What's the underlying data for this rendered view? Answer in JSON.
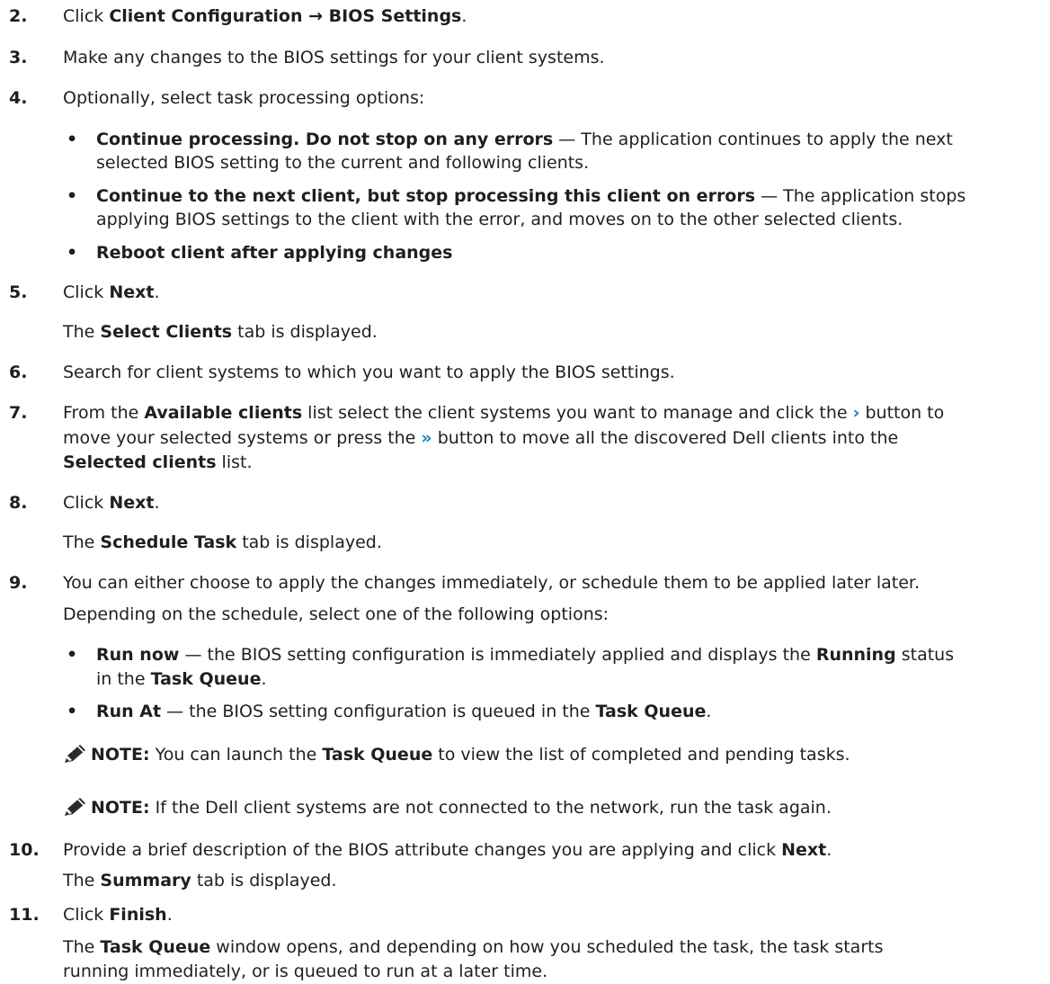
{
  "steps": {
    "s2": {
      "num": "2.",
      "pre": "Click ",
      "b1": "Client Configuration",
      "arrow": " → ",
      "b2": "BIOS Settings",
      "post": "."
    },
    "s3": {
      "num": "3.",
      "text": "Make any changes to the BIOS settings for your client systems."
    },
    "s4": {
      "num": "4.",
      "text": "Optionally, select task processing options:",
      "bullets": [
        {
          "bold": "Continue processing. Do not stop on any errors",
          "line1": " — The application continues to apply the next",
          "line2": "selected BIOS setting to the current and following clients."
        },
        {
          "bold": "Continue to the next client, but stop processing this client on errors",
          "line1": " — The application stops",
          "line2": "applying BIOS settings to the client with the error, and moves on to the other selected clients."
        },
        {
          "bold": "Reboot client after applying changes"
        }
      ]
    },
    "s5": {
      "num": "5.",
      "pre": "Click ",
      "bold": "Next",
      "post": ".",
      "r_pre": "The ",
      "r_bold": "Select Clients",
      "r_post": " tab is displayed."
    },
    "s6": {
      "num": "6.",
      "text": "Search for client systems to which you want to apply the BIOS settings."
    },
    "s7": {
      "num": "7.",
      "l1_pre": "From the ",
      "l1_bold": "Available clients",
      "l1_mid": " list select the client systems you want to manage and click the ",
      "l1_icon": "›",
      "l1_post": " button to",
      "l2_pre": "move your selected systems or press the ",
      "l2_icon": "»",
      "l2_post": " button to move all the discovered Dell clients into the",
      "l3_bold": "Selected clients",
      "l3_post": " list."
    },
    "s8": {
      "num": "8.",
      "pre": "Click ",
      "bold": "Next",
      "post": ".",
      "r_pre": "The ",
      "r_bold": "Schedule Task",
      "r_post": " tab is displayed."
    },
    "s9": {
      "num": "9.",
      "text": "You can either choose to apply the changes immediately, or schedule them to be applied later later.",
      "text2": "Depending on the schedule, select one of the following options:",
      "bullets": [
        {
          "bold": "Run now",
          "l1a": " — the BIOS setting configuration is immediately applied and displays the ",
          "l1b": "Running",
          "l1c": " status",
          "l2a": "in the ",
          "l2b": "Task Queue",
          "l2c": "."
        },
        {
          "bold": "Run At",
          "l1a": " — the BIOS setting configuration is queued in the ",
          "l1b": "Task Queue",
          "l1c": "."
        }
      ],
      "notes": [
        {
          "label": "NOTE:",
          "a": " You can launch the ",
          "b": "Task Queue",
          "c": " to view the list of completed and pending tasks."
        },
        {
          "label": "NOTE:",
          "a": " If the Dell client systems are not connected to the network, run the task again.",
          "b": "",
          "c": ""
        }
      ]
    },
    "s10": {
      "num": "10.",
      "pre": "Provide a brief description of the BIOS attribute changes you are applying and click ",
      "bold": "Next",
      "post": ".",
      "r_pre": "The ",
      "r_bold": "Summary",
      "r_post": " tab is displayed."
    },
    "s11": {
      "num": "11.",
      "pre": "Click ",
      "bold": "Finish",
      "post": ".",
      "r_pre": "The ",
      "r_bold": "Task Queue",
      "r_post": " window opens, and depending on how you scheduled the task, the task starts",
      "r2": "running immediately, or is queued to run at a later time."
    }
  },
  "icons": {
    "note": "note-pencil-icon",
    "next": "chevron-right-icon",
    "all": "double-chevron-right-icon"
  },
  "colors": {
    "text": "#1f1f1f",
    "chevron": "#1a7fc4"
  }
}
